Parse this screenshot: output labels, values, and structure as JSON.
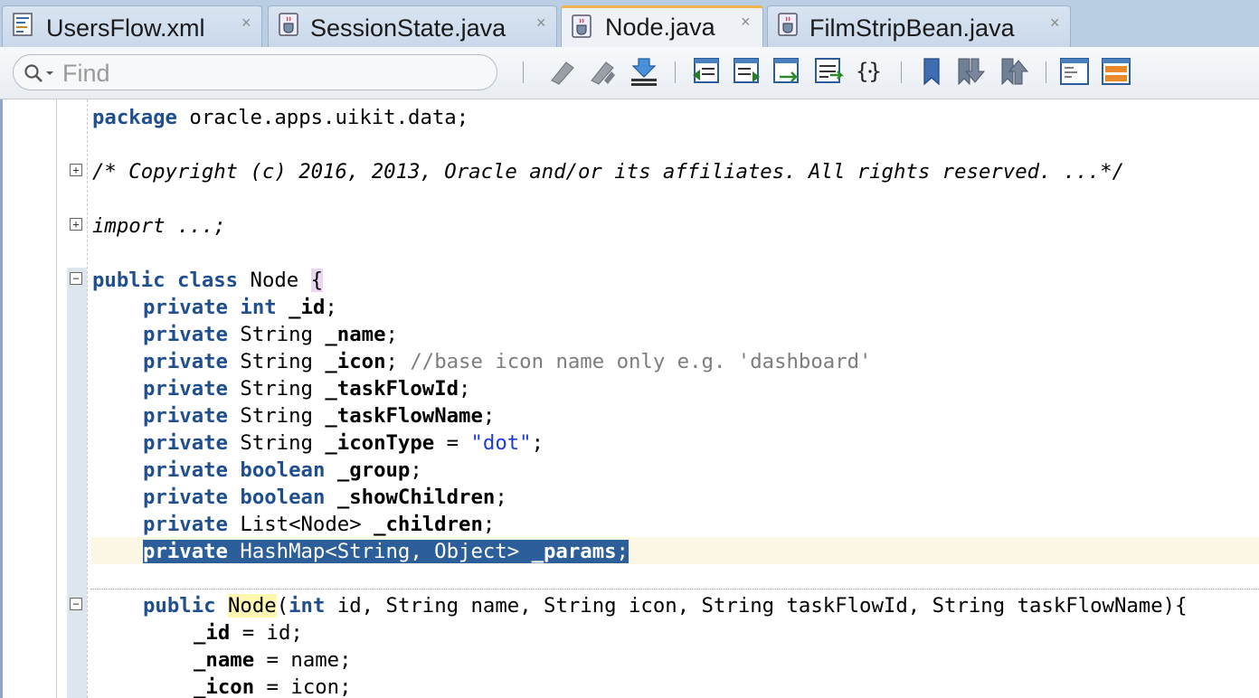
{
  "tabs": [
    {
      "label": "UsersFlow.xml",
      "close": "×",
      "icon": "xml-file-icon",
      "active": false
    },
    {
      "label": "SessionState.java",
      "close": "×",
      "icon": "java-file-icon",
      "active": false
    },
    {
      "label": "Node.java",
      "close": "×",
      "icon": "java-file-icon",
      "active": true
    },
    {
      "label": "FilmStripBean.java",
      "close": "×",
      "icon": "java-file-icon",
      "active": false
    }
  ],
  "toolbar": {
    "find_placeholder": "Find",
    "find_value": "",
    "icons": [
      "previous-occurrence-icon",
      "next-occurrence-icon",
      "toggle-highlight-icon",
      "shift-left-icon",
      "shift-right-icon",
      "comment-icon",
      "uncomment-icon",
      "format-code-icon",
      "toggle-bookmark-icon",
      "previous-bookmark-icon",
      "next-bookmark-icon",
      "split-vertical-icon",
      "split-horizontal-icon"
    ]
  },
  "code": {
    "l1": {
      "kw": "package",
      "rest": " oracle.apps.uikit.data;"
    },
    "l2": {
      "text": "/* Copyright (c) 2016, 2013, Oracle and/or its affiliates. All rights reserved. ...*/"
    },
    "l3": {
      "text": "import ...;"
    },
    "l4": {
      "kw": "public class",
      "name": " Node ",
      "brace": "{"
    },
    "l5": {
      "kw": "private",
      "kw2": "int",
      "field": "_id",
      "end": ";"
    },
    "l6": {
      "kw": "private",
      "type": " String ",
      "field": "_name",
      "end": ";"
    },
    "l7": {
      "kw": "private",
      "type": " String ",
      "field": "_icon",
      "end": "; ",
      "comment": "//base icon name only e.g. 'dashboard'"
    },
    "l8": {
      "kw": "private",
      "type": " String ",
      "field": "_taskFlowId",
      "end": ";"
    },
    "l9": {
      "kw": "private",
      "type": " String ",
      "field": "_taskFlowName",
      "end": ";"
    },
    "l10": {
      "kw": "private",
      "type": " String ",
      "field": "_iconType",
      "eq": " = ",
      "str": "\"dot\"",
      "end": ";"
    },
    "l11": {
      "kw": "private",
      "kw2": "boolean",
      "field": "_group",
      "end": ";"
    },
    "l12": {
      "kw": "private",
      "kw2": "boolean",
      "field": "_showChildren",
      "end": ";"
    },
    "l13": {
      "kw": "private",
      "type": " List<Node> ",
      "field": "_children",
      "end": ";"
    },
    "l14": {
      "kw": "private",
      "type": " HashMap<String, Object> ",
      "field": "_params",
      "end": ";"
    },
    "l15": {
      "kw": "public",
      "ctor": "Node",
      "open": "(",
      "kw2": "int",
      "params": " id, String name, String icon, String taskFlowId, String taskFlowName){"
    },
    "l16": {
      "field": "_id",
      "rest": " = id;"
    },
    "l17": {
      "field": "_name",
      "rest": " = name;"
    },
    "l18": {
      "field": "_icon",
      "rest": " = icon;"
    }
  },
  "colors": {
    "keyword": "#1f4f8f",
    "string": "#1b3ce0",
    "comment": "#7d7d7d",
    "selection": "#2c5f99",
    "active_tab_accent": "#f0b450"
  }
}
